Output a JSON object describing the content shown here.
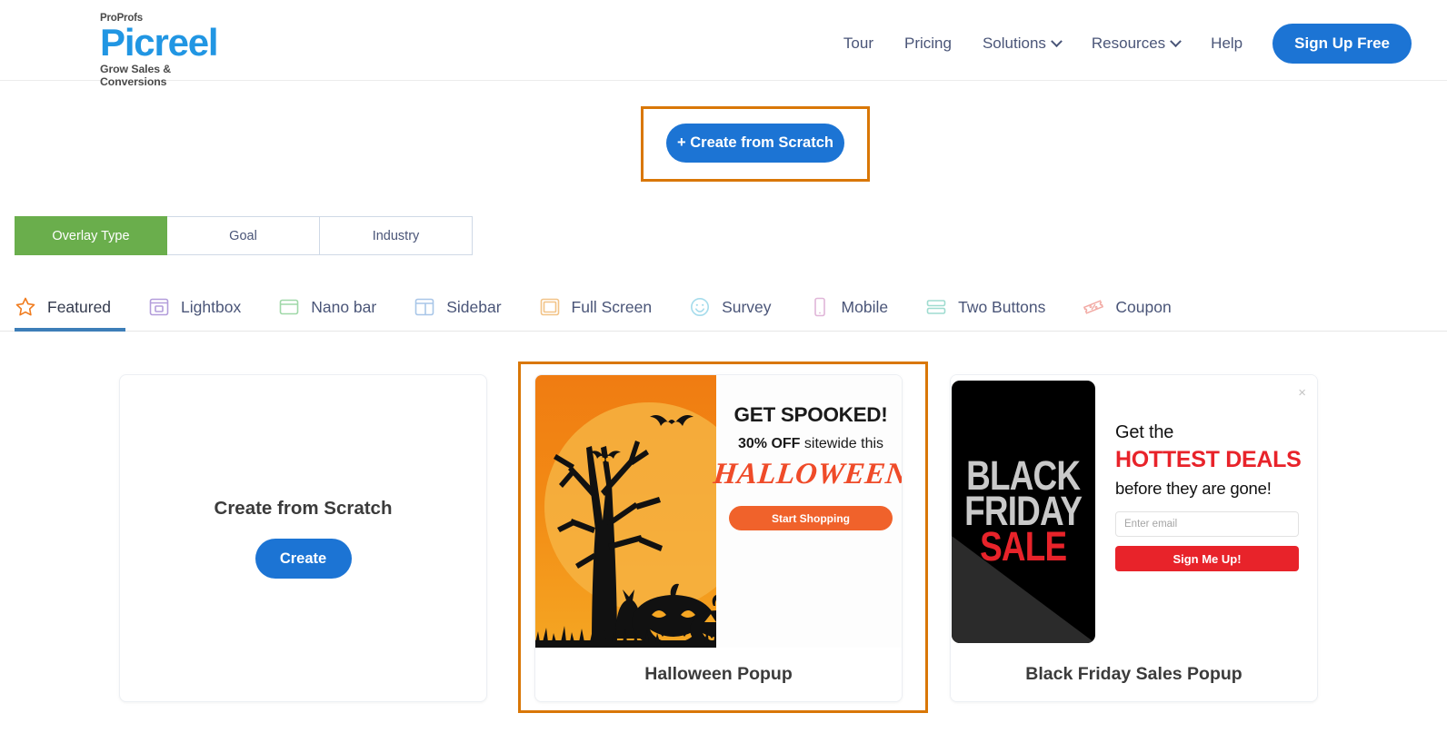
{
  "header": {
    "logo": {
      "brand_prefix": "ProProfs",
      "brand": "Picreel",
      "tagline": "Grow Sales & Conversions",
      "brand_color": "#2196e3"
    },
    "nav": [
      {
        "label": "Tour",
        "has_dropdown": false
      },
      {
        "label": "Pricing",
        "has_dropdown": false
      },
      {
        "label": "Solutions",
        "has_dropdown": true
      },
      {
        "label": "Resources",
        "has_dropdown": true
      },
      {
        "label": "Help",
        "has_dropdown": false
      }
    ],
    "signup_label": "Sign Up Free",
    "signup_color": "#1c74d4"
  },
  "toolbar": {
    "create_from_scratch_label": "+ Create from Scratch",
    "highlight_color": "#d97706"
  },
  "segmented": {
    "items": [
      {
        "label": "Overlay Type",
        "active": true
      },
      {
        "label": "Goal",
        "active": false
      },
      {
        "label": "Industry",
        "active": false
      }
    ],
    "active_color": "#6aae4c"
  },
  "categories": [
    {
      "label": "Featured",
      "icon": "star-icon",
      "color": "#F07B1D",
      "active": true
    },
    {
      "label": "Lightbox",
      "icon": "lightbox-icon",
      "color": "#b39ddb",
      "active": false
    },
    {
      "label": "Nano bar",
      "icon": "nanobar-icon",
      "color": "#9fd8a8",
      "active": false
    },
    {
      "label": "Sidebar",
      "icon": "sidebar-icon",
      "color": "#a8c6e8",
      "active": false
    },
    {
      "label": "Full Screen",
      "icon": "fullscreen-icon",
      "color": "#f2c387",
      "active": false
    },
    {
      "label": "Survey",
      "icon": "survey-smiley-icon",
      "color": "#a6dcec",
      "active": false
    },
    {
      "label": "Mobile",
      "icon": "mobile-icon",
      "color": "#e0b6d8",
      "active": false
    },
    {
      "label": "Two Buttons",
      "icon": "two-buttons-icon",
      "color": "#9fdcd0",
      "active": false
    },
    {
      "label": "Coupon",
      "icon": "coupon-icon",
      "color": "#f2aaa4",
      "active": false
    }
  ],
  "cards": {
    "scratch": {
      "title": "Create from Scratch",
      "button_label": "Create"
    },
    "halloween": {
      "caption": "Halloween Popup",
      "highlighted": true,
      "preview": {
        "headline": "GET SPOOKED!",
        "sub_bold": "30% OFF",
        "sub_rest": " sitewide this",
        "word": "HALLOWEEN",
        "cta_label": "Start Shopping",
        "cta_color": "#F0622B",
        "bg_color": "#F28A14"
      }
    },
    "blackfriday": {
      "caption": "Black Friday Sales Popup",
      "highlighted": false,
      "preview": {
        "art_line1": "BLACK",
        "art_line2": "FRIDAY",
        "art_line3": "SALE",
        "t1": "Get the",
        "t2": "HOTTEST DEALS",
        "t3": "before they are gone!",
        "email_placeholder": "Enter email",
        "cta_label": "Sign Me Up!",
        "cta_color": "#E8232A",
        "close_glyph": "×"
      }
    }
  }
}
